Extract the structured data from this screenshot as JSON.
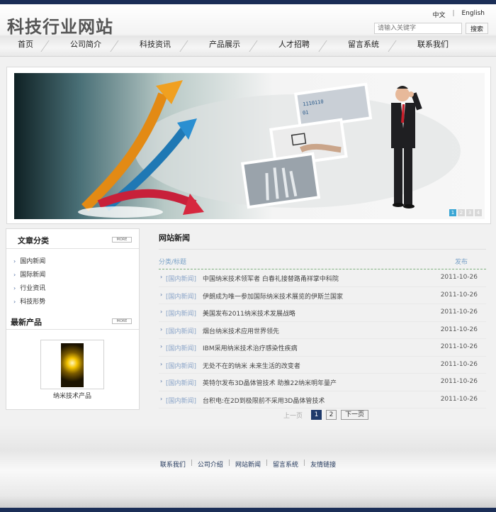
{
  "site": {
    "title": "科技行业网站"
  },
  "lang": {
    "cn": "中文",
    "sep": "|",
    "en": "English"
  },
  "search": {
    "placeholder": "请输入关键字",
    "button": "搜索"
  },
  "nav": {
    "items": [
      "首页",
      "公司简介",
      "科技资讯",
      "产品展示",
      "人才招聘",
      "留言系统",
      "联系我们"
    ]
  },
  "banner": {
    "dots": [
      "1",
      "2",
      "3",
      "4"
    ],
    "active": 1
  },
  "sidebar": {
    "categories_title": "文章分类",
    "more_label": "MORE",
    "categories": [
      "国内新闻",
      "国际新闻",
      "行业资讯",
      "科技形势"
    ],
    "products_title": "最新产品",
    "product_name": "纳米技术产品"
  },
  "news": {
    "title": "网站新闻",
    "col_category": "分类/标题",
    "col_date": "发布",
    "rows": [
      {
        "cat": "[国内新闻]",
        "title": "中国纳米技术领军者 白春礼接替路甬祥掌中科院",
        "date": "2011-10-26"
      },
      {
        "cat": "[国内新闻]",
        "title": "伊朗成为唯一参加国际纳米技术展览的伊斯兰国家",
        "date": "2011-10-26"
      },
      {
        "cat": "[国内新闻]",
        "title": "美国发布2011纳米技术发展战略",
        "date": "2011-10-26"
      },
      {
        "cat": "[国内新闻]",
        "title": "烟台纳米技术应用世界领先",
        "date": "2011-10-26"
      },
      {
        "cat": "[国内新闻]",
        "title": "IBM采用纳米技术治疗感染性疾病",
        "date": "2011-10-26"
      },
      {
        "cat": "[国内新闻]",
        "title": "无处不在的纳米 未来生活的改变者",
        "date": "2011-10-26"
      },
      {
        "cat": "[国内新闻]",
        "title": "英特尔发布3D晶体管技术 助推22纳米明年量产",
        "date": "2011-10-26"
      },
      {
        "cat": "[国内新闻]",
        "title": "台积电:在2D到极限前不采用3D晶体管技术",
        "date": "2011-10-26"
      }
    ]
  },
  "pager": {
    "prev": "上一页",
    "pages": [
      "1",
      "2"
    ],
    "current": "1",
    "next": "下一页"
  },
  "footer": {
    "links": [
      "联系我们",
      "公司介绍",
      "网站新闻",
      "留言系统",
      "友情链接"
    ]
  },
  "colors": {
    "topbar": "#1b2e57",
    "accent": "#1f3a6b",
    "link": "#4a6aa0"
  }
}
